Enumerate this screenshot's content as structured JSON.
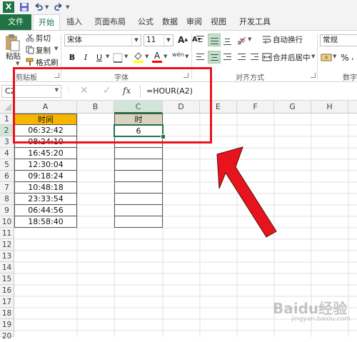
{
  "quick_access": {
    "app_icon": "excel-icon",
    "save_icon": "save-icon",
    "undo_icon": "undo-icon",
    "redo_icon": "redo-icon",
    "customize_icon": "customize-qat-icon"
  },
  "tabs": [
    {
      "label": "文件"
    },
    {
      "label": "开始"
    },
    {
      "label": "插入"
    },
    {
      "label": "页面布局"
    },
    {
      "label": "公式"
    },
    {
      "label": "数据"
    },
    {
      "label": "审阅"
    },
    {
      "label": "视图"
    },
    {
      "label": "开发工具"
    }
  ],
  "ribbon": {
    "clipboard": {
      "paste": "粘贴",
      "cut": "剪切",
      "copy": "复制",
      "format_painter": "格式刷",
      "group": "剪贴板"
    },
    "font": {
      "font_name": "宋体",
      "font_size": "11",
      "group": "字体",
      "bold": "B",
      "italic": "I",
      "underline": "U",
      "grow": "A",
      "shrink": "A",
      "font_color_letter": "A",
      "phonetic": "wén"
    },
    "alignment": {
      "wrap_text": "自动换行",
      "merge_center": "合并后居中",
      "group": "对齐方式"
    },
    "number": {
      "format": "常规",
      "percent": "%",
      "group": "数字"
    }
  },
  "formula_bar": {
    "name_box": "C2",
    "cancel": "✕",
    "enter": "✓",
    "fx": "fx",
    "formula": "=HOUR(A2)"
  },
  "columns": [
    "A",
    "B",
    "C",
    "D",
    "E",
    "F",
    "G",
    "H"
  ],
  "rows": [
    "1",
    "2",
    "3",
    "4",
    "5",
    "6",
    "7",
    "8",
    "9",
    "10",
    "11",
    "12",
    "13",
    "14",
    "15",
    "16",
    "17",
    "18",
    "19",
    "20"
  ],
  "sheet": {
    "a1": "时间",
    "c1": "时",
    "c2": "6",
    "times": [
      "06:32:42",
      "08:24:10",
      "16:45:20",
      "12:30:04",
      "09:18:24",
      "10:48:18",
      "23:33:54",
      "06:44:56",
      "18:58:40"
    ]
  },
  "watermark": {
    "text": "Baidu经验",
    "sub": "jingyan.baidu.com"
  },
  "colors": {
    "excel_green": "#217346",
    "header_fill": "#f7b500",
    "c1_fill": "#d9d3bf",
    "annotation_red": "#e8141d"
  }
}
